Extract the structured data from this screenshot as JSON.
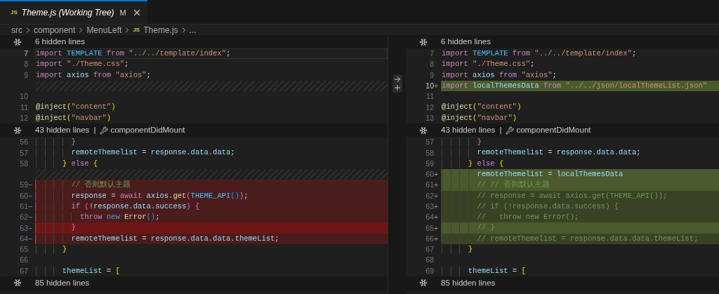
{
  "tab": {
    "icon_text": "JS",
    "title": "Theme.js (Working Tree)",
    "status": "M",
    "selected": true
  },
  "breadcrumbs": [
    {
      "label": "src"
    },
    {
      "label": "component"
    },
    {
      "label": "MenuLeft"
    },
    {
      "label": "Theme.js",
      "icon_text": "JS"
    },
    {
      "label": "..."
    }
  ],
  "panes": [
    {
      "rows": [
        {
          "kind": "hidden",
          "text": "6 hidden lines"
        },
        {
          "kind": "line",
          "number": "7",
          "current": true,
          "tokens": [
            {
              "kind": "kw",
              "text": "import"
            },
            {
              "kind": "const",
              "text": " TEMPLATE"
            },
            {
              "kind": "kw",
              "text": " from"
            },
            {
              "kind": "str",
              "text": " \"../../template/index\""
            },
            {
              "kind": "p",
              "text": ";"
            }
          ]
        },
        {
          "kind": "line",
          "number": "8",
          "current": false,
          "tokens": [
            {
              "kind": "kw",
              "text": "import"
            },
            {
              "kind": "str",
              "text": " \"./Theme.css\""
            },
            {
              "kind": "p",
              "text": ";"
            }
          ]
        },
        {
          "kind": "line",
          "number": "9",
          "current": false,
          "tokens": [
            {
              "kind": "kw",
              "text": "import"
            },
            {
              "kind": "var",
              "text": " axios"
            },
            {
              "kind": "kw",
              "text": " from"
            },
            {
              "kind": "str",
              "text": " \"axios\""
            },
            {
              "kind": "p",
              "text": ";"
            }
          ]
        },
        {
          "kind": "filler"
        },
        {
          "kind": "line",
          "number": "10",
          "current": false
        },
        {
          "kind": "line",
          "number": "11",
          "current": false,
          "tokens": [
            {
              "kind": "fn",
              "text": "@inject"
            },
            {
              "kind": "b1",
              "text": "("
            },
            {
              "kind": "str",
              "text": "\"content\""
            },
            {
              "kind": "b1",
              "text": ")"
            }
          ]
        },
        {
          "kind": "line",
          "number": "12",
          "current": false,
          "tokens": [
            {
              "kind": "fn",
              "text": "@inject"
            },
            {
              "kind": "b1",
              "text": "("
            },
            {
              "kind": "str",
              "text": "\"navbar\""
            },
            {
              "kind": "b1",
              "text": ")"
            }
          ]
        },
        {
          "kind": "hidden",
          "text": "43 hidden lines",
          "separator": "|",
          "symbol": "componentDidMount"
        },
        {
          "kind": "line",
          "number": "56",
          "current": false,
          "tokens": [
            {
              "kind": "b2",
              "text": "        }"
            }
          ]
        },
        {
          "kind": "line",
          "number": "57",
          "current": false,
          "tokens": [
            {
              "kind": "var",
              "text": "        remoteThemelist"
            },
            {
              "kind": "p",
              "text": " = "
            },
            {
              "kind": "var",
              "text": "response"
            },
            {
              "kind": "p",
              "text": "."
            },
            {
              "kind": "var",
              "text": "data"
            },
            {
              "kind": "p",
              "text": "."
            },
            {
              "kind": "var",
              "text": "data"
            },
            {
              "kind": "p",
              "text": ";"
            }
          ]
        },
        {
          "kind": "line",
          "number": "58",
          "current": false,
          "tokens": [
            {
              "kind": "b1",
              "text": "      }"
            },
            {
              "kind": "kw",
              "text": " else"
            },
            {
              "kind": "b1",
              "text": " {"
            }
          ]
        },
        {
          "kind": "filler"
        },
        {
          "kind": "removed",
          "number": "59",
          "marker": "−",
          "strong": false,
          "current": false,
          "tokens": [
            {
              "kind": "cmt",
              "text": "        // 否则默认主题"
            }
          ]
        },
        {
          "kind": "removed",
          "number": "60",
          "marker": "−",
          "strong": false,
          "current": false,
          "tokens": [
            {
              "kind": "var",
              "text": "        response"
            },
            {
              "kind": "p",
              "text": " = "
            },
            {
              "kind": "kw",
              "text": "await"
            },
            {
              "kind": "var",
              "text": " axios"
            },
            {
              "kind": "p",
              "text": "."
            },
            {
              "kind": "fn",
              "text": "get"
            },
            {
              "kind": "b2",
              "text": "("
            },
            {
              "kind": "const",
              "text": "THEME_API"
            },
            {
              "kind": "b3",
              "text": "()"
            },
            {
              "kind": "b2",
              "text": ")"
            },
            {
              "kind": "p",
              "text": ";"
            }
          ]
        },
        {
          "kind": "removed",
          "number": "61",
          "marker": "−",
          "strong": false,
          "current": false,
          "tokens": [
            {
              "kind": "kw",
              "text": "        if"
            },
            {
              "kind": "b2",
              "text": " ("
            },
            {
              "kind": "p",
              "text": "!"
            },
            {
              "kind": "var",
              "text": "response"
            },
            {
              "kind": "p",
              "text": "."
            },
            {
              "kind": "var",
              "text": "data"
            },
            {
              "kind": "p",
              "text": "."
            },
            {
              "kind": "var",
              "text": "success"
            },
            {
              "kind": "b2",
              "text": ")"
            },
            {
              "kind": "b2",
              "text": " {"
            }
          ]
        },
        {
          "kind": "removed",
          "number": "62",
          "marker": "−",
          "strong": false,
          "current": false,
          "tokens": [
            {
              "kind": "kw",
              "text": "          throw"
            },
            {
              "kind": "kw2",
              "text": " new"
            },
            {
              "kind": "fn",
              "text": " Error"
            },
            {
              "kind": "b3",
              "text": "()"
            },
            {
              "kind": "p",
              "text": ";"
            }
          ]
        },
        {
          "kind": "removed",
          "number": "63",
          "marker": "−",
          "strong": true,
          "current": false,
          "tokens": [
            {
              "kind": "b2",
              "text": "        }"
            }
          ]
        },
        {
          "kind": "removed",
          "number": "64",
          "marker": "−",
          "strong": false,
          "current": false,
          "tokens": [
            {
              "kind": "var",
              "text": "        remoteThemelist"
            },
            {
              "kind": "p",
              "text": " = "
            },
            {
              "kind": "var",
              "text": "response"
            },
            {
              "kind": "p",
              "text": "."
            },
            {
              "kind": "var",
              "text": "data"
            },
            {
              "kind": "p",
              "text": "."
            },
            {
              "kind": "var",
              "text": "data"
            },
            {
              "kind": "p",
              "text": "."
            },
            {
              "kind": "var",
              "text": "themeList"
            },
            {
              "kind": "p",
              "text": ";"
            }
          ]
        },
        {
          "kind": "line",
          "number": "65",
          "current": false,
          "tokens": [
            {
              "kind": "b1",
              "text": "      }"
            }
          ]
        },
        {
          "kind": "line",
          "number": "66",
          "current": false
        },
        {
          "kind": "line",
          "number": "67",
          "current": false,
          "tokens": [
            {
              "kind": "var",
              "text": "      themeList"
            },
            {
              "kind": "p",
              "text": " = "
            },
            {
              "kind": "b1",
              "text": "["
            }
          ]
        },
        {
          "kind": "hidden",
          "text": "85 hidden lines"
        }
      ]
    },
    {
      "rows": [
        {
          "kind": "hidden",
          "text": "6 hidden lines"
        },
        {
          "kind": "line",
          "number": "7",
          "current": false,
          "tokens": [
            {
              "kind": "kw",
              "text": "import"
            },
            {
              "kind": "const",
              "text": " TEMPLATE"
            },
            {
              "kind": "kw",
              "text": " from"
            },
            {
              "kind": "str",
              "text": " \"../../template/index\""
            },
            {
              "kind": "p",
              "text": ";"
            }
          ]
        },
        {
          "kind": "line",
          "number": "8",
          "current": false,
          "tokens": [
            {
              "kind": "kw",
              "text": "import"
            },
            {
              "kind": "str",
              "text": " \"./Theme.css\""
            },
            {
              "kind": "p",
              "text": ";"
            }
          ]
        },
        {
          "kind": "line",
          "number": "9",
          "current": false,
          "tokens": [
            {
              "kind": "kw",
              "text": "import"
            },
            {
              "kind": "var",
              "text": " axios"
            },
            {
              "kind": "kw",
              "text": " from"
            },
            {
              "kind": "str",
              "text": " \"axios\""
            },
            {
              "kind": "p",
              "text": ";"
            }
          ]
        },
        {
          "kind": "added",
          "number": "10",
          "marker": "+",
          "strong": true,
          "current": true,
          "tokens": [
            {
              "kind": "kw",
              "text": "import"
            },
            {
              "kind": "var",
              "text": " localThemesData"
            },
            {
              "kind": "kw",
              "text": " from"
            },
            {
              "kind": "str",
              "text": " \"../../json/localThemeList.json\""
            }
          ]
        },
        {
          "kind": "line",
          "number": "11",
          "current": false
        },
        {
          "kind": "line",
          "number": "12",
          "current": false,
          "tokens": [
            {
              "kind": "fn",
              "text": "@inject"
            },
            {
              "kind": "b1",
              "text": "("
            },
            {
              "kind": "str",
              "text": "\"content\""
            },
            {
              "kind": "b1",
              "text": ")"
            }
          ]
        },
        {
          "kind": "line",
          "number": "13",
          "current": false,
          "tokens": [
            {
              "kind": "fn",
              "text": "@inject"
            },
            {
              "kind": "b1",
              "text": "("
            },
            {
              "kind": "str",
              "text": "\"navbar\""
            },
            {
              "kind": "b1",
              "text": ")"
            }
          ]
        },
        {
          "kind": "hidden",
          "text": "43 hidden lines",
          "separator": "|",
          "symbol": "componentDidMount"
        },
        {
          "kind": "line",
          "number": "57",
          "current": false,
          "tokens": [
            {
              "kind": "b2",
              "text": "        }"
            }
          ]
        },
        {
          "kind": "line",
          "number": "58",
          "current": false,
          "tokens": [
            {
              "kind": "var",
              "text": "        remoteThemelist"
            },
            {
              "kind": "p",
              "text": " = "
            },
            {
              "kind": "var",
              "text": "response"
            },
            {
              "kind": "p",
              "text": "."
            },
            {
              "kind": "var",
              "text": "data"
            },
            {
              "kind": "p",
              "text": "."
            },
            {
              "kind": "var",
              "text": "data"
            },
            {
              "kind": "p",
              "text": ";"
            }
          ]
        },
        {
          "kind": "line",
          "number": "59",
          "current": false,
          "tokens": [
            {
              "kind": "b1",
              "text": "      }"
            },
            {
              "kind": "kw",
              "text": " else"
            },
            {
              "kind": "b1",
              "text": " {"
            }
          ]
        },
        {
          "kind": "added",
          "number": "60",
          "marker": "+",
          "strong": true,
          "current": false,
          "tokens": [
            {
              "kind": "var",
              "text": "        remoteThemelist"
            },
            {
              "kind": "p",
              "text": " = "
            },
            {
              "kind": "var",
              "text": "localThemesData"
            }
          ]
        },
        {
          "kind": "added",
          "number": "61",
          "marker": "+",
          "strong": true,
          "current": false,
          "tokens": [
            {
              "kind": "cmt",
              "text": "        // // 否则默认主题"
            }
          ]
        },
        {
          "kind": "added",
          "number": "62",
          "marker": "+",
          "strong": false,
          "current": false,
          "tokens": [
            {
              "kind": "cmt",
              "text": "        // response = await axios.get(THEME_API());"
            }
          ]
        },
        {
          "kind": "added",
          "number": "63",
          "marker": "+",
          "strong": false,
          "current": false,
          "tokens": [
            {
              "kind": "cmt",
              "text": "        // if (!response.data.success) {"
            }
          ]
        },
        {
          "kind": "added",
          "number": "64",
          "marker": "+",
          "strong": false,
          "current": false,
          "tokens": [
            {
              "kind": "cmt",
              "text": "        //   throw new Error();"
            }
          ]
        },
        {
          "kind": "added",
          "number": "65",
          "marker": "+",
          "strong": true,
          "current": false,
          "tokens": [
            {
              "kind": "cmt",
              "text": "        // }"
            }
          ]
        },
        {
          "kind": "added",
          "number": "66",
          "marker": "+",
          "strong": false,
          "current": false,
          "tokens": [
            {
              "kind": "cmt",
              "text": "        // remoteThemelist = response.data.data.themeList;"
            }
          ]
        },
        {
          "kind": "line",
          "number": "67",
          "current": false,
          "tokens": [
            {
              "kind": "b1",
              "text": "      }"
            }
          ]
        },
        {
          "kind": "line",
          "number": "68",
          "current": false
        },
        {
          "kind": "line",
          "number": "69",
          "current": false,
          "tokens": [
            {
              "kind": "var",
              "text": "      themeList"
            },
            {
              "kind": "p",
              "text": " = "
            },
            {
              "kind": "b1",
              "text": "["
            }
          ]
        },
        {
          "kind": "hidden",
          "text": "85 hidden lines"
        }
      ]
    }
  ]
}
